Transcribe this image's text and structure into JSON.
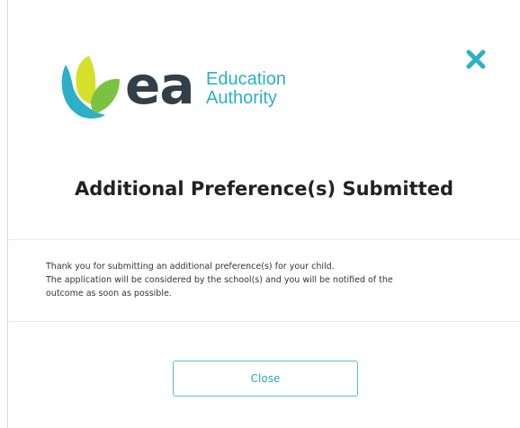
{
  "logo": {
    "brand": "ea",
    "line1": "Education",
    "line2": "Authority",
    "colors": {
      "leaf_yellow": "#d4e02a",
      "leaf_green": "#7cc242",
      "leaf_teal": "#2bb0c5",
      "wordmark": "#333f48",
      "tagline": "#2bb0c5"
    }
  },
  "dialog": {
    "close_icon": "close-x-icon",
    "close_icon_color": "#2bb0c5",
    "title": "Additional Preference(s) Submitted",
    "message": [
      "Thank you for submitting an additional preference(s) for your child.",
      "The application will be considered by the school(s) and you will be notified of the",
      "outcome as soon as possible."
    ],
    "close_button_label": "Close",
    "accent": "#2aa6bb"
  }
}
